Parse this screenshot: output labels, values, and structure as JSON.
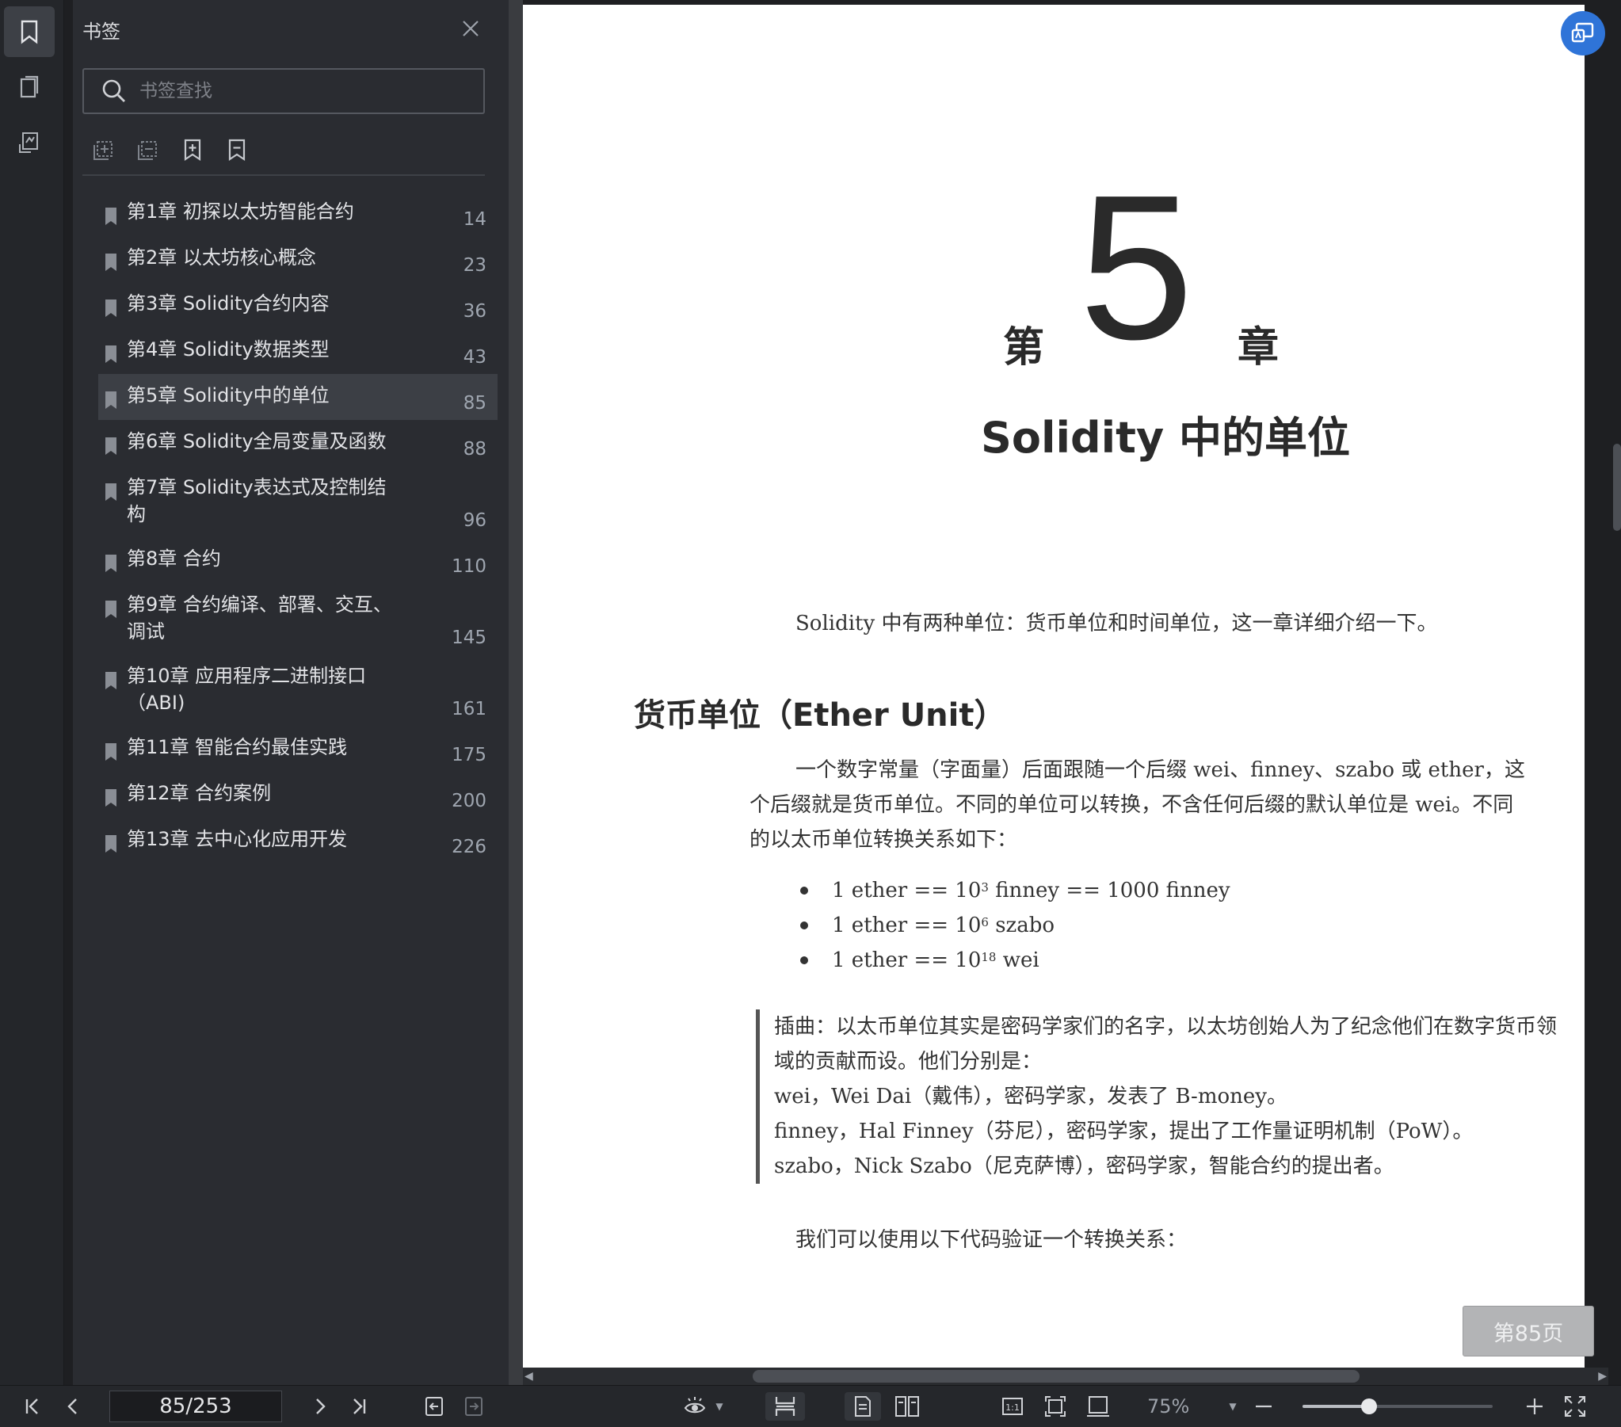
{
  "sidebar": {
    "title": "书签",
    "search_placeholder": "书签查找",
    "bookmarks": [
      {
        "label": "第1章 初探以太坊智能合约",
        "page": "14"
      },
      {
        "label": "第2章 以太坊核心概念",
        "page": "23"
      },
      {
        "label": "第3章 Solidity合约内容",
        "page": "36"
      },
      {
        "label": "第4章 Solidity数据类型",
        "page": "43"
      },
      {
        "label": "第5章 Solidity中的单位",
        "page": "85",
        "selected": true
      },
      {
        "label": "第6章 Solidity全局变量及函数",
        "page": "88"
      },
      {
        "label": "第7章 Solidity表达式及控制结构",
        "page": "96"
      },
      {
        "label": "第8章 合约",
        "page": "110"
      },
      {
        "label": "第9章 合约编译、部署、交互、调试",
        "page": "145"
      },
      {
        "label": "第10章 应用程序二进制接口（ABI)",
        "page": "161"
      },
      {
        "label": "第11章 智能合约最佳实践",
        "page": "175"
      },
      {
        "label": "第12章 合约案例",
        "page": "200"
      },
      {
        "label": "第13章 去中心化应用开发",
        "page": "226"
      }
    ]
  },
  "document": {
    "chapter_prefix": "第",
    "chapter_number": "5",
    "chapter_suffix": "章",
    "chapter_title": "Solidity 中的单位",
    "intro": "Solidity 中有两种单位：货币单位和时间单位，这一章详细介绍一下。",
    "section_heading": "货币单位（Ether Unit）",
    "paragraph": "一个数字常量（字面量）后面跟随一个后缀 wei、finney、szabo 或 ether，这个后缀就是货币单位。不同的单位可以转换，不含任何后缀的默认单位是 wei。不同的以太币单位转换关系如下：",
    "bullets": [
      {
        "lead": "1 ether == 10",
        "exp": "3",
        "tail": " finney == 1000 finney"
      },
      {
        "lead": "1 ether == 10",
        "exp": "6",
        "tail": " szabo"
      },
      {
        "lead": "1 ether == 10",
        "exp": "18",
        "tail": " wei"
      }
    ],
    "quote_lines": [
      "插曲：以太币单位其实是密码学家们的名字，以太坊创始人为了纪念他们在数字货币领域的贡献而设。他们分别是：",
      "wei，Wei Dai（戴伟），密码学家，发表了 B-money。",
      "finney，Hal Finney（芬尼），密码学家，提出了工作量证明机制（PoW）。",
      "szabo，Nick Szabo（尼克萨博），密码学家，智能合约的提出者。"
    ],
    "closing": "我们可以使用以下代码验证一个转换关系：",
    "page_tag": "第85页"
  },
  "bottom_bar": {
    "page_indicator": "85/253",
    "zoom": "75%",
    "zoom_fraction": 0.35
  },
  "colors": {
    "accent": "#2f74d8",
    "sidebar_bg": "#2a2c31",
    "selected_row": "#3c3f45"
  }
}
